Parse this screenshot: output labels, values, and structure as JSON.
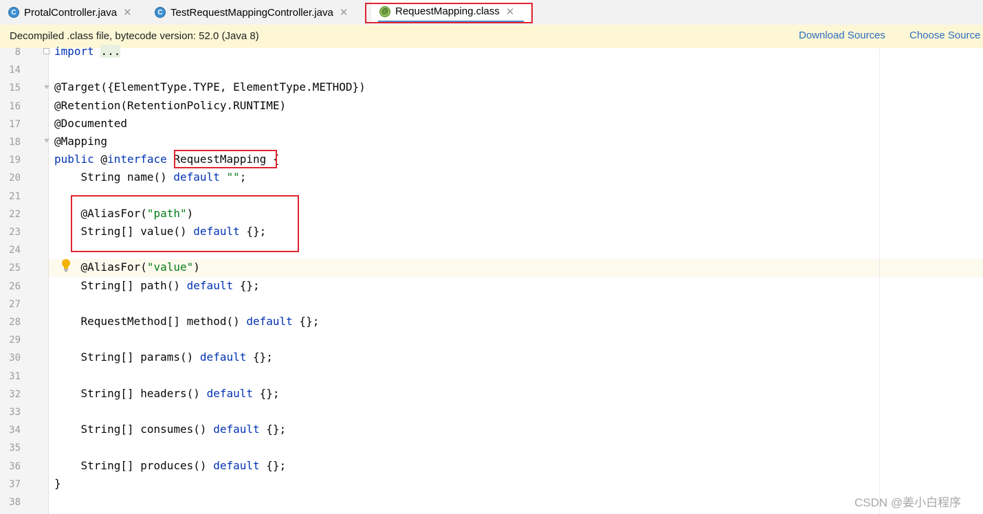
{
  "tabs": [
    {
      "label": "ProtalController.java",
      "icon": "class-c-icon",
      "icon_glyph": "C"
    },
    {
      "label": "TestRequestMappingController.java",
      "icon": "class-c-icon",
      "icon_glyph": "C"
    },
    {
      "label": "RequestMapping.class",
      "icon": "annotation-icon",
      "icon_glyph": "@"
    }
  ],
  "banner": {
    "message": "Decompiled .class file, bytecode version: 52.0 (Java 8)",
    "download_sources": "Download Sources",
    "choose_sources": "Choose Source"
  },
  "code": {
    "lines": [
      {
        "num": "8",
        "tokens": [
          [
            "kw",
            "import"
          ],
          [
            "",
            " "
          ],
          [
            "dots",
            "..."
          ]
        ]
      },
      {
        "num": "14",
        "tokens": []
      },
      {
        "num": "15",
        "tokens": [
          [
            "",
            "@Target({ElementType.TYPE, ElementType.METHOD})"
          ]
        ]
      },
      {
        "num": "16",
        "tokens": [
          [
            "",
            "@Retention(RetentionPolicy.RUNTIME)"
          ]
        ]
      },
      {
        "num": "17",
        "tokens": [
          [
            "",
            "@Documented"
          ]
        ]
      },
      {
        "num": "18",
        "tokens": [
          [
            "",
            "@Mapping"
          ]
        ]
      },
      {
        "num": "19",
        "tokens": [
          [
            "kw",
            "public"
          ],
          [
            "",
            " @"
          ],
          [
            "kw",
            "interface"
          ],
          [
            "",
            " RequestMapping {"
          ]
        ]
      },
      {
        "num": "20",
        "tokens": [
          [
            "",
            "    String name() "
          ],
          [
            "kw",
            "default"
          ],
          [
            "",
            " "
          ],
          [
            "str",
            "\"\""
          ],
          [
            "",
            ";"
          ]
        ]
      },
      {
        "num": "21",
        "tokens": []
      },
      {
        "num": "22",
        "tokens": [
          [
            "",
            "    @AliasFor("
          ],
          [
            "str",
            "\"path\""
          ],
          [
            "",
            ")"
          ]
        ]
      },
      {
        "num": "23",
        "tokens": [
          [
            "",
            "    String[] value() "
          ],
          [
            "kw",
            "default"
          ],
          [
            "",
            " {};"
          ]
        ]
      },
      {
        "num": "24",
        "tokens": []
      },
      {
        "num": "25",
        "tokens": [
          [
            "",
            "    @AliasFor("
          ],
          [
            "str",
            "\"value\""
          ],
          [
            "",
            ")"
          ]
        ]
      },
      {
        "num": "26",
        "tokens": [
          [
            "",
            "    String[] path() "
          ],
          [
            "kw",
            "default"
          ],
          [
            "",
            " {};"
          ]
        ]
      },
      {
        "num": "27",
        "tokens": []
      },
      {
        "num": "28",
        "tokens": [
          [
            "",
            "    RequestMethod[] method() "
          ],
          [
            "kw",
            "default"
          ],
          [
            "",
            " {};"
          ]
        ]
      },
      {
        "num": "29",
        "tokens": []
      },
      {
        "num": "30",
        "tokens": [
          [
            "",
            "    String[] params() "
          ],
          [
            "kw",
            "default"
          ],
          [
            "",
            " {};"
          ]
        ]
      },
      {
        "num": "31",
        "tokens": []
      },
      {
        "num": "32",
        "tokens": [
          [
            "",
            "    String[] headers() "
          ],
          [
            "kw",
            "default"
          ],
          [
            "",
            " {};"
          ]
        ]
      },
      {
        "num": "33",
        "tokens": []
      },
      {
        "num": "34",
        "tokens": [
          [
            "",
            "    String[] consumes() "
          ],
          [
            "kw",
            "default"
          ],
          [
            "",
            " {};"
          ]
        ]
      },
      {
        "num": "35",
        "tokens": []
      },
      {
        "num": "36",
        "tokens": [
          [
            "",
            "    String[] produces() "
          ],
          [
            "kw",
            "default"
          ],
          [
            "",
            " {};"
          ]
        ]
      },
      {
        "num": "37",
        "tokens": [
          [
            "",
            "}"
          ]
        ]
      },
      {
        "num": "38",
        "tokens": []
      }
    ],
    "highlighted_line": "25"
  },
  "watermark": "CSDN @姜小白程序",
  "colors": {
    "keyword": "#0033b3",
    "string": "#067d17",
    "annotation_box": "#e0242f",
    "banner_bg": "#fdf7d6",
    "link": "#2d6cc0"
  }
}
